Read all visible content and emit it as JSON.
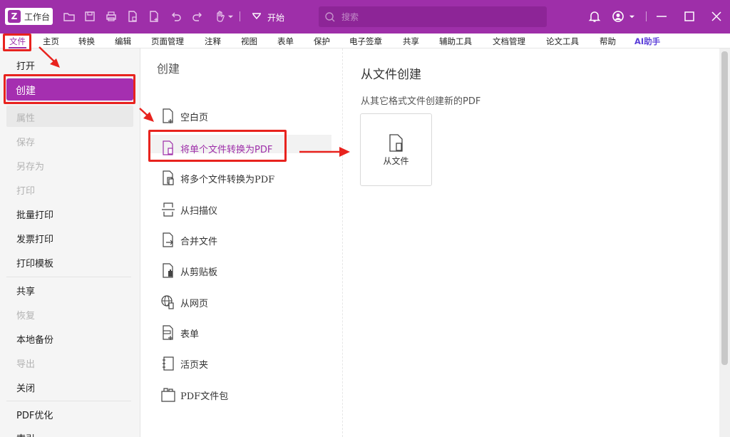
{
  "titlebar": {
    "workspace_label": "工作台",
    "start_label": "开始",
    "search_placeholder": "搜索",
    "icons": [
      "folder-icon",
      "save-icon",
      "print-icon",
      "export-icon",
      "new-file-icon",
      "undo-icon",
      "redo-icon",
      "hand-icon",
      "dropdown-icon",
      "bell-icon",
      "user-icon",
      "minimize-icon",
      "maximize-icon",
      "close-icon"
    ]
  },
  "menubar": {
    "items": [
      "文件",
      "主页",
      "转换",
      "编辑",
      "页面管理",
      "注释",
      "视图",
      "表单",
      "保护",
      "电子签章",
      "共享",
      "辅助工具",
      "文档管理",
      "论文工具",
      "帮助",
      "AI助手"
    ]
  },
  "left_menu": {
    "items": [
      {
        "label": "打开",
        "state": "normal"
      },
      {
        "label": "创建",
        "state": "active"
      },
      {
        "label": "属性",
        "state": "disabled"
      },
      {
        "label": "保存",
        "state": "disabled"
      },
      {
        "label": "另存为",
        "state": "disabled"
      },
      {
        "label": "打印",
        "state": "disabled"
      },
      {
        "label": "批量打印",
        "state": "normal"
      },
      {
        "label": "发票打印",
        "state": "normal"
      },
      {
        "label": "打印模板",
        "state": "normal"
      },
      {
        "label": "共享",
        "state": "normal"
      },
      {
        "label": "恢复",
        "state": "disabled"
      },
      {
        "label": "本地备份",
        "state": "normal"
      },
      {
        "label": "导出",
        "state": "disabled"
      },
      {
        "label": "关闭",
        "state": "normal"
      },
      {
        "label": "PDF优化",
        "state": "normal"
      },
      {
        "label": "索引",
        "state": "normal"
      }
    ]
  },
  "create_panel": {
    "title": "创建",
    "items": [
      {
        "label": "空白页",
        "icon": "blank-page-icon"
      },
      {
        "label": "将单个文件转换为PDF",
        "icon": "single-file-icon",
        "selected": true
      },
      {
        "label": "将多个文件转换为PDF",
        "icon": "multi-file-icon"
      },
      {
        "label": "从扫描仪",
        "icon": "scanner-icon"
      },
      {
        "label": "合并文件",
        "icon": "merge-icon"
      },
      {
        "label": "从剪贴板",
        "icon": "clipboard-icon"
      },
      {
        "label": "从网页",
        "icon": "globe-icon"
      },
      {
        "label": "表单",
        "icon": "form-icon"
      },
      {
        "label": "活页夹",
        "icon": "binder-icon"
      },
      {
        "label": "PDF文件包",
        "icon": "portfolio-icon"
      }
    ]
  },
  "detail_panel": {
    "title": "从文件创建",
    "subtitle": "从其它格式文件创建新的PDF",
    "card_label": "从文件"
  },
  "colors": {
    "brand": "#9e2fa9",
    "active_item": "#a52fb0",
    "annotation_red": "#e8231e"
  }
}
